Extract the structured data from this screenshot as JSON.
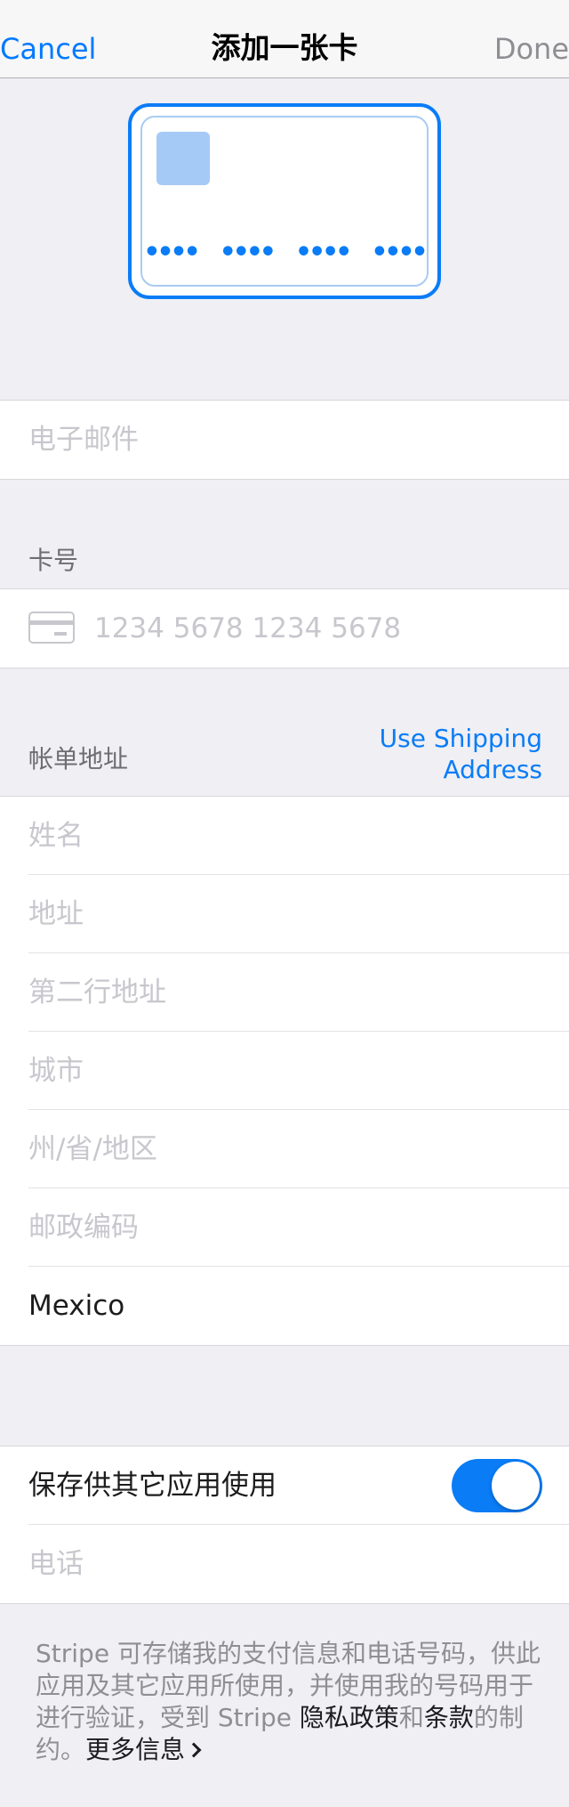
{
  "nav": {
    "cancel": "Cancel",
    "title": "添加一张卡",
    "done": "Done"
  },
  "card_preview": {
    "dots": "•••• •••• •••• ••••"
  },
  "email": {
    "placeholder": "电子邮件"
  },
  "card_number": {
    "header": "卡号",
    "placeholder": "1234 5678 1234 5678"
  },
  "billing": {
    "header": "帐单地址",
    "use_shipping_line1": "Use Shipping",
    "use_shipping_line2": "Address",
    "fields": [
      {
        "placeholder": "姓名"
      },
      {
        "placeholder": "地址"
      },
      {
        "placeholder": "第二行地址"
      },
      {
        "placeholder": "城市"
      },
      {
        "placeholder": "州/省/地区"
      },
      {
        "placeholder": "邮政编码"
      }
    ],
    "country": "Mexico"
  },
  "link": {
    "save_label": "保存供其它应用使用",
    "save_enabled": true,
    "phone_placeholder": "电话"
  },
  "footer": {
    "text_part1": "Stripe 可存储我的支付信息和电话号码，供此应用及其它应用所使用，并使用我的号码用于进行验证，受到 Stripe ",
    "privacy_link": "隐私政策",
    "text_part2": "和",
    "terms_link": "条款",
    "text_part3": "的制约。",
    "more_info": "更多信息"
  },
  "colors": {
    "accent": "#0A7CF6",
    "background": "#EFEFF4",
    "placeholder": "#C7C7CD"
  }
}
